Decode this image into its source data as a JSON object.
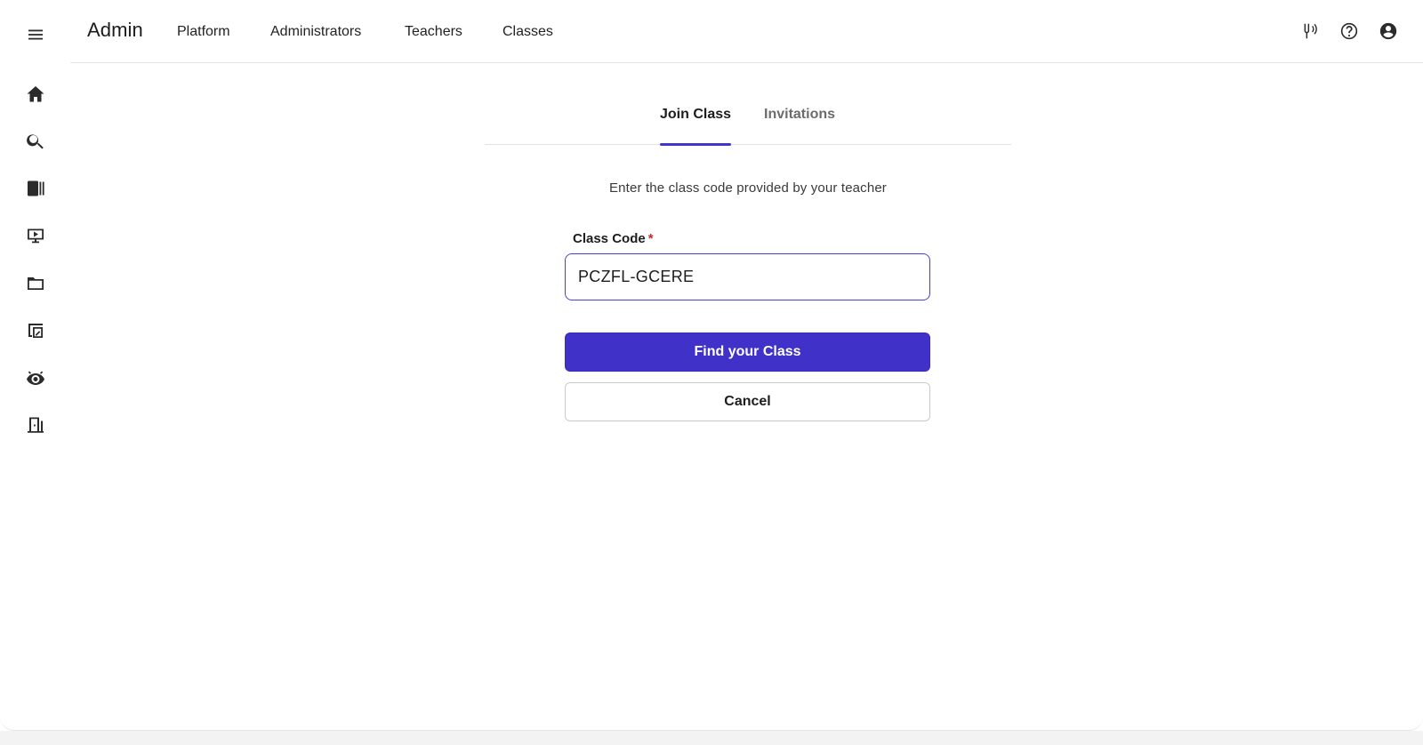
{
  "app": {
    "brand": "Admin"
  },
  "nav": {
    "links": [
      "Platform",
      "Administrators",
      "Teachers",
      "Classes"
    ]
  },
  "topbar_icons": [
    "accessibility-icon",
    "help-icon",
    "account-icon"
  ],
  "sidebar": {
    "menu_icon": "menu-icon",
    "items": [
      "home-icon",
      "search-icon",
      "library-icon",
      "media-icon",
      "folder-icon",
      "assignment-icon",
      "view-icon",
      "exit-icon"
    ]
  },
  "tabs": [
    {
      "label": "Join Class",
      "active": true
    },
    {
      "label": "Invitations",
      "active": false
    }
  ],
  "form": {
    "instructions": "Enter the class code provided by your teacher",
    "label": "Class Code",
    "required_mark": "*",
    "value": "PCZFL-GCERE",
    "submit_label": "Find your Class",
    "cancel_label": "Cancel"
  },
  "colors": {
    "accent": "#4032c8",
    "required": "#c42b2b"
  }
}
